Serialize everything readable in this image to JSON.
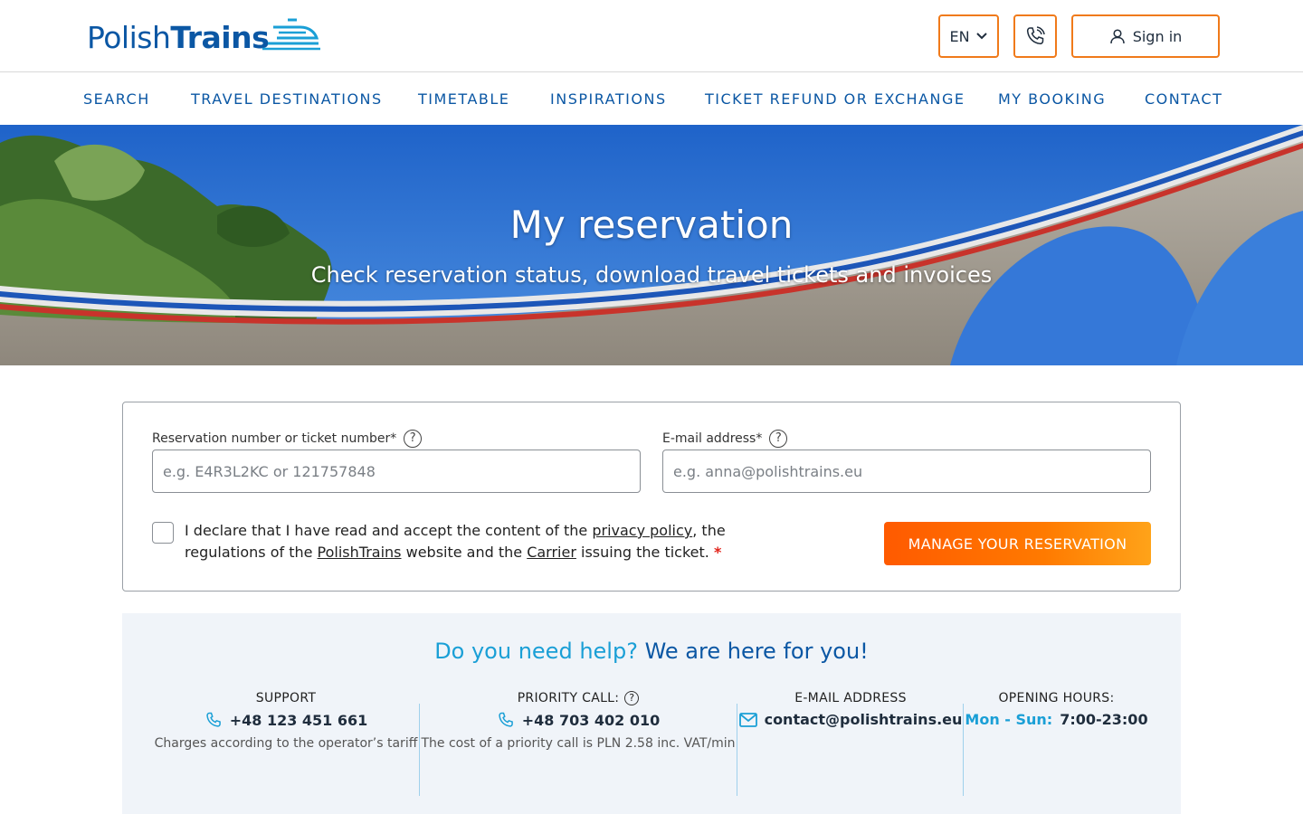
{
  "brand": {
    "logo_light": "Polish",
    "logo_bold": "Trains",
    "color": "#0b57a4",
    "accent": "#f07a1a"
  },
  "header": {
    "language": "EN",
    "phone_icon": "phone-icon",
    "sign_in_label": "Sign in"
  },
  "nav": {
    "items": [
      {
        "label": "SEARCH"
      },
      {
        "label": "TRAVEL DESTINATIONS"
      },
      {
        "label": "TIMETABLE"
      },
      {
        "label": "INSPIRATIONS"
      },
      {
        "label": "TICKET REFUND OR EXCHANGE"
      },
      {
        "label": "MY BOOKING"
      },
      {
        "label": "CONTACT"
      }
    ]
  },
  "hero": {
    "title": "My reservation",
    "subtitle": "Check reservation status, download travel tickets and invoices"
  },
  "form": {
    "reservation_label": "Reservation number or ticket number*",
    "reservation_placeholder": "e.g. E4R3L2KC or 121757848",
    "email_label": "E-mail address*",
    "email_placeholder": "e.g. anna@polishtrains.eu",
    "help_glyph": "?",
    "declare_part1": "I declare that I have read and accept the content of the ",
    "privacy_link": "privacy policy",
    "declare_part2": ", the regulations of the ",
    "polishtrains_link": "PolishTrains",
    "declare_part3": " website and the ",
    "carrier_link": "Carrier",
    "declare_part4": " issuing the ticket. ",
    "required_mark": "*",
    "submit_label": "MANAGE YOUR RESERVATION"
  },
  "help": {
    "title_question": "Do you need help?",
    "title_answer": "We are here for you!",
    "support": {
      "heading": "SUPPORT",
      "value": "+48 123 451 661",
      "note": "Charges according to the operator’s tariff"
    },
    "priority": {
      "heading": "PRIORITY CALL:",
      "value": "+48 703 402 010",
      "note": "The cost of a priority call is PLN 2.58 inc. VAT/min"
    },
    "email": {
      "heading": "E-MAIL ADDRESS",
      "value": "contact@polishtrains.eu"
    },
    "hours": {
      "heading": "OPENING HOURS:",
      "days": "Mon - Sun:",
      "time": "7:00-23:00"
    }
  }
}
